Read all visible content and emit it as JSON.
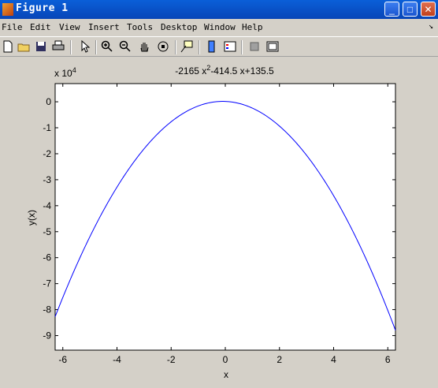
{
  "window": {
    "title": "Figure 1",
    "minimize": "_",
    "maximize": "□",
    "close": "✕"
  },
  "menu": {
    "items": [
      "File",
      "Edit",
      "View",
      "Insert",
      "Tools",
      "Desktop",
      "Window",
      "Help"
    ],
    "overflow_arrow": "↘"
  },
  "toolbar": {
    "icons": [
      "new-file-icon",
      "open-folder-icon",
      "save-icon",
      "print-icon",
      "pointer-icon",
      "zoom-in-icon",
      "zoom-out-icon",
      "pan-hand-icon",
      "rotate-3d-icon",
      "data-cursor-icon",
      "colorbar-icon",
      "legend-icon",
      "hide-plot-tools-icon",
      "show-plot-tools-icon"
    ]
  },
  "chart_data": {
    "type": "line",
    "title": "-2165 x²-414.5 x+135.5",
    "title_parts": {
      "a": "-2165 x",
      "exp": "2",
      "b": "-414.5 x+135.5"
    },
    "xlabel": "x",
    "ylabel": "y(x)",
    "y_multiplier": "x 10",
    "y_multiplier_exp": "4",
    "xlim": [
      -6.2832,
      6.2832
    ],
    "ylim": [
      -95600,
      7000
    ],
    "xticks": [
      -6,
      -4,
      -2,
      0,
      2,
      4,
      6
    ],
    "yticks": [
      0,
      -10000,
      -20000,
      -30000,
      -40000,
      -50000,
      -60000,
      -70000,
      -80000,
      -90000
    ],
    "ytick_labels": [
      "0",
      "-1",
      "-2",
      "-3",
      "-4",
      "-5",
      "-6",
      "-7",
      "-8",
      "-9"
    ],
    "series": [
      {
        "color": "#0000ff",
        "coefficients": [
          -2165,
          -414.5,
          135.5
        ],
        "x_range": [
          -6.2832,
          6.2832
        ]
      }
    ],
    "grid": false
  }
}
